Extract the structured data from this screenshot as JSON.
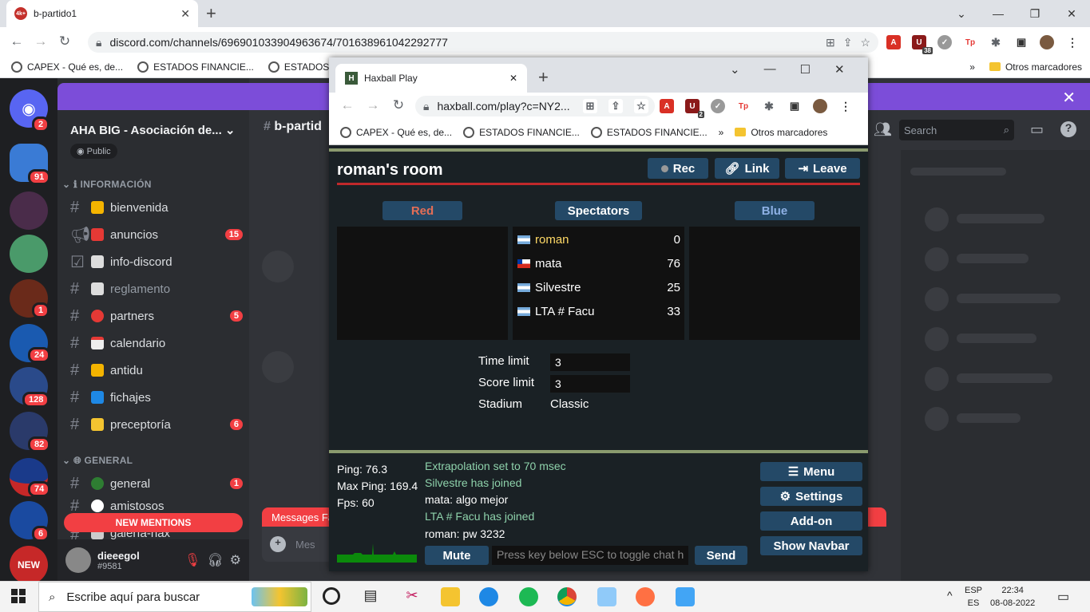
{
  "browser": {
    "tab_title": "b-partido1",
    "url": "discord.com/channels/696901033904963674/701638961042292777",
    "bookmarks": [
      "CAPEX - Qué es, de...",
      "ESTADOS FINANCIE...",
      "ESTADOS FIN"
    ],
    "other_bookmarks": "Otros marcadores",
    "ext_badge": "38"
  },
  "discord": {
    "banner_color": "#7c4dd9",
    "guild_name": "AHA BIG - Asociación de...",
    "public_label": "Public",
    "server_badges": [
      "2",
      "91",
      "1",
      "24",
      "128",
      "82",
      "74",
      "6"
    ],
    "category_info": "INFORMACIÓN",
    "category_general": "GENERAL",
    "channels": [
      {
        "name": "bienvenida",
        "badge": ""
      },
      {
        "name": "anuncios",
        "badge": "15"
      },
      {
        "name": "info-discord",
        "badge": ""
      },
      {
        "name": "reglamento",
        "badge": ""
      },
      {
        "name": "partners",
        "badge": "5"
      },
      {
        "name": "calendario",
        "badge": ""
      },
      {
        "name": "antidu",
        "badge": ""
      },
      {
        "name": "fichajes",
        "badge": ""
      },
      {
        "name": "preceptoría",
        "badge": "6"
      }
    ],
    "general_channels": [
      {
        "name": "general",
        "badge": "1"
      },
      {
        "name": "amistosos",
        "badge": ""
      },
      {
        "name": "galería-hax",
        "badge": ""
      }
    ],
    "new_mentions": "NEW MENTIONS",
    "new_label": "NEW",
    "username": "dieeegol",
    "usertag": "#9581",
    "channel_header": "b-partid",
    "search_placeholder": "Search",
    "messages_label": "Messages Fa",
    "msg_placeholder": "Mes"
  },
  "hax": {
    "tab_title": "Haxball Play",
    "url": "haxball.com/play?c=NY2...",
    "bookmarks": [
      "CAPEX - Qué es, de...",
      "ESTADOS FINANCIE...",
      "ESTADOS FINANCIE..."
    ],
    "other_bookmarks": "Otros marcadores",
    "ext_badge": "2",
    "room_title": "roman's room",
    "rec": "Rec",
    "link": "Link",
    "leave": "Leave",
    "red": "Red",
    "spectators": "Spectators",
    "blue": "Blue",
    "players": [
      {
        "name": "roman",
        "score": "0",
        "flag": "ar",
        "highlight": true
      },
      {
        "name": "mata",
        "score": "76",
        "flag": "cl"
      },
      {
        "name": "Silvestre",
        "score": "25",
        "flag": "ar"
      },
      {
        "name": "LTA # Facu",
        "score": "33",
        "flag": "ar"
      }
    ],
    "time_limit_label": "Time limit",
    "time_limit": "3",
    "score_limit_label": "Score limit",
    "score_limit": "3",
    "stadium_label": "Stadium",
    "stadium": "Classic",
    "ping": "Ping: 76.3",
    "max_ping": "Max Ping: 169.4",
    "fps": "Fps: 60",
    "messages": [
      {
        "text": "Extrapolation set to 70 msec",
        "color": "green"
      },
      {
        "text": "Silvestre has joined",
        "color": "green"
      },
      {
        "text": "mata: algo mejor",
        "color": "white"
      },
      {
        "text": "LTA # Facu has joined",
        "color": "green"
      },
      {
        "text": "roman: pw 3232",
        "color": "white"
      }
    ],
    "mute": "Mute",
    "chat_placeholder": "Press key below ESC to toggle chat h",
    "send": "Send",
    "menu": "Menu",
    "settings": "Settings",
    "addon": "Add-on",
    "show_navbar": "Show Navbar"
  },
  "taskbar": {
    "search": "Escribe aquí para buscar",
    "lang1": "ESP",
    "lang2": "ES",
    "time": "22:34",
    "date": "08-08-2022"
  }
}
